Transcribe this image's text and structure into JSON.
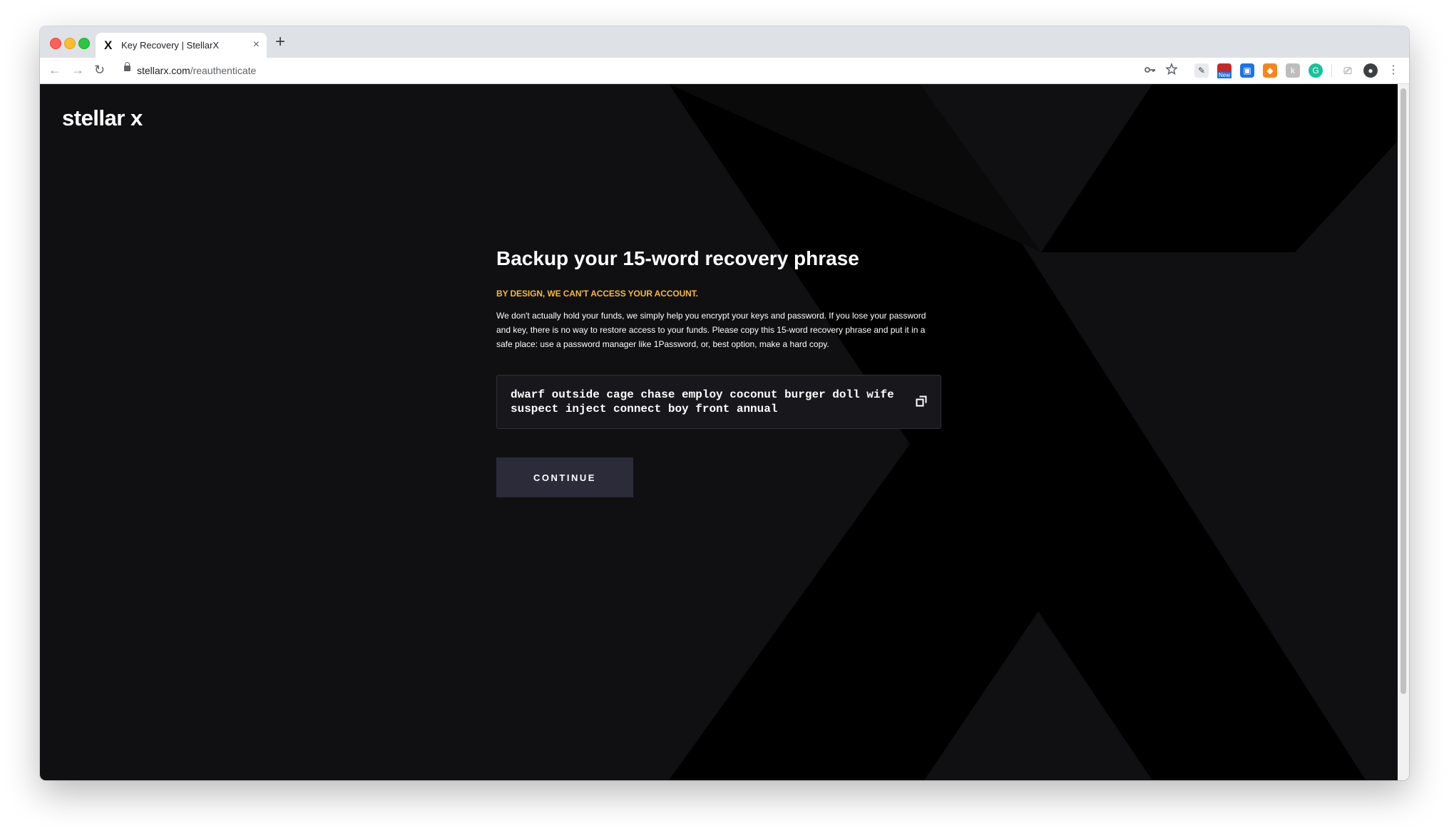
{
  "browser": {
    "tab": {
      "favicon": "X",
      "title": "Key Recovery | StellarX",
      "close": "×"
    },
    "new_tab": "+",
    "nav": {
      "back": "←",
      "forward": "→",
      "reload": "↻"
    },
    "url": {
      "host": "stellarx.com",
      "path": "/reauthenticate"
    },
    "omnibox_icons": [
      "key-icon",
      "star-icon"
    ],
    "extensions": [
      "ext-pencil-icon",
      "ext-new-badge-icon",
      "ext-blue-icon",
      "ext-fox-icon",
      "ext-grey-icon",
      "ext-grammarly-icon",
      "cast-icon",
      "profile-icon",
      "menu-icon"
    ],
    "new_badge": "New"
  },
  "page": {
    "logo": "stellar x",
    "heading": "Backup your 15-word recovery phrase",
    "warning": "BY DESIGN, WE CAN'T ACCESS YOUR ACCOUNT.",
    "body": "We don't actually hold your funds, we simply help you encrypt your keys and password. If you lose your password and key, there is no way to restore access to your funds. Please copy this 15-word recovery phrase and put it in a safe place: use a password manager like 1Password, or, best option, make a hard copy.",
    "phrase": "dwarf outside cage chase employ coconut burger doll wife suspect inject connect boy front annual",
    "continue_label": "CONTINUE"
  },
  "colors": {
    "page_bg": "#101012",
    "x_shape": "#000000",
    "warning": "#f5b93d",
    "button_bg": "#2b2b3a",
    "phrase_bg": "#18181c"
  }
}
